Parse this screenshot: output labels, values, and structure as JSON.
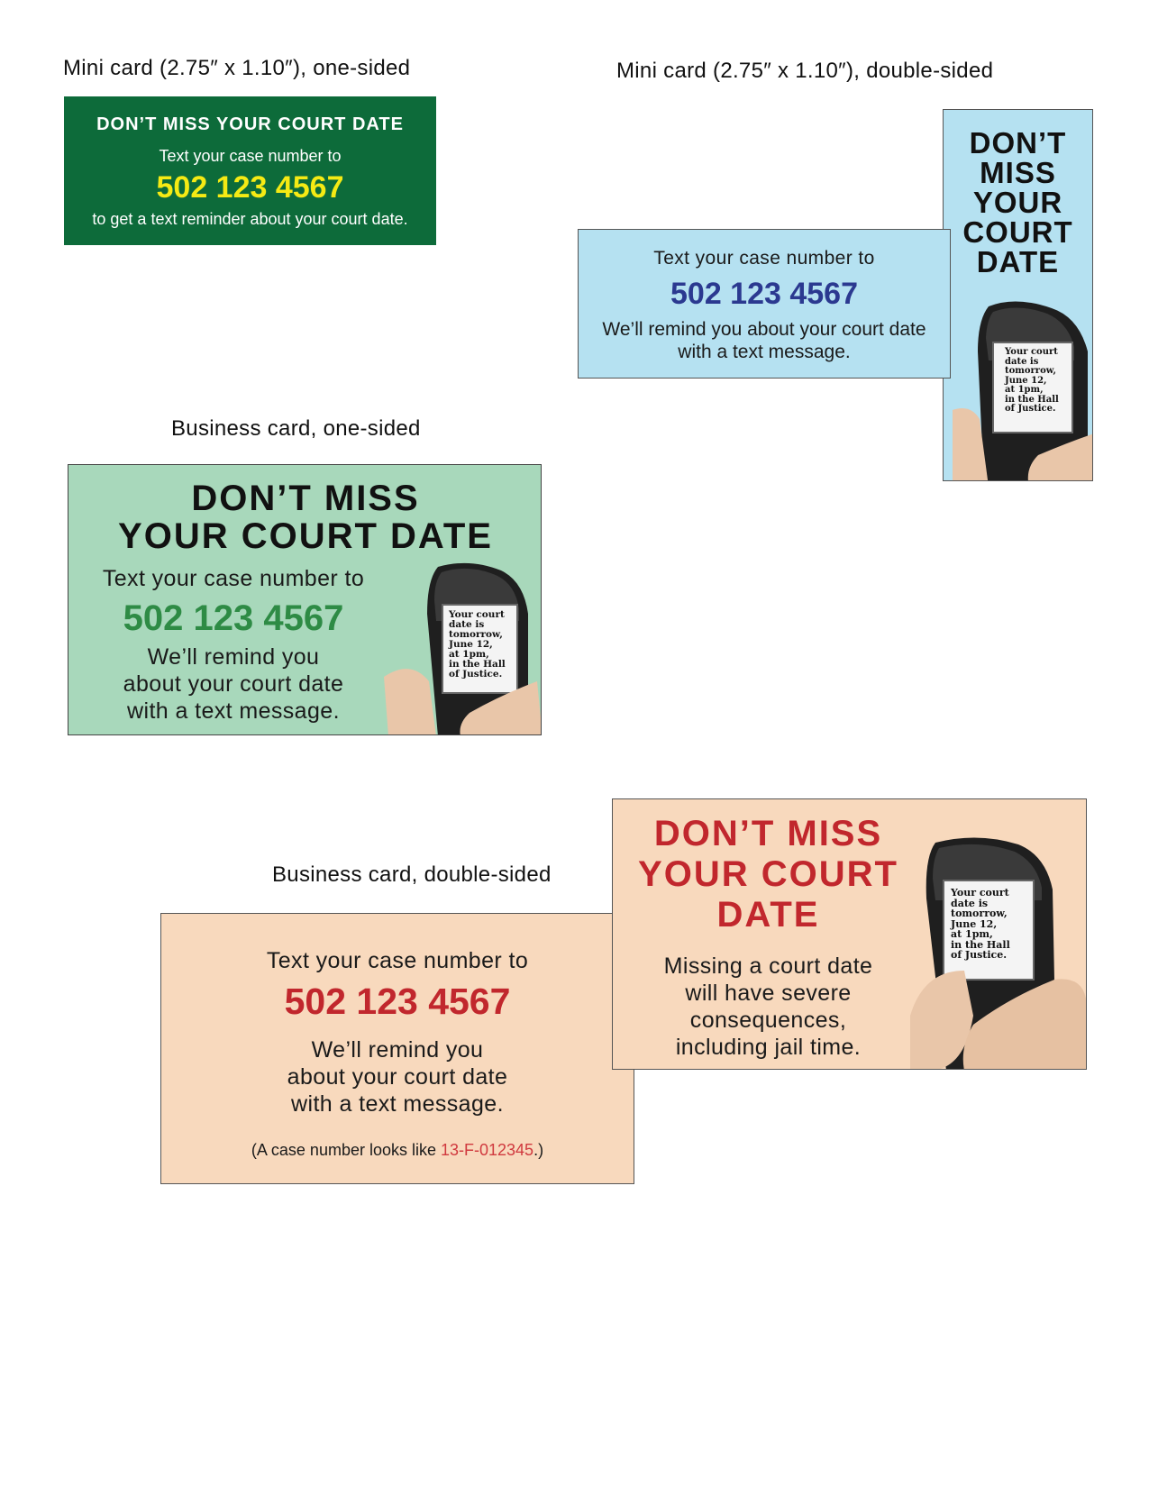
{
  "captions": {
    "mini_one": "Mini card (2.75″ x 1.10″), one-sided",
    "mini_double": "Mini card (2.75″ x 1.10″), double-sided",
    "business_one": "Business card, one-sided",
    "business_double": "Business card, double-sided"
  },
  "mini_one": {
    "headline": "DON’T MISS YOUR COURT DATE",
    "line1": "Text your case number to",
    "phone": "502 123 4567",
    "line2": "to get a text reminder about your court date."
  },
  "mini_double": {
    "front_headline": [
      "DON’T",
      "MISS",
      "YOUR",
      "COURT",
      "DATE"
    ],
    "back_line1": "Text your case number to",
    "back_phone": "502 123 4567",
    "back_line2a": "We’ll remind you about your court date",
    "back_line2b": "with a text message."
  },
  "business_one": {
    "headline_a": "DON’T MISS",
    "headline_b": "YOUR COURT DATE",
    "line1": "Text your case number to",
    "phone": "502 123 4567",
    "line2": [
      "We’ll remind you",
      "about your court date",
      "with a text message."
    ]
  },
  "business_double": {
    "front_headline": [
      "DON’T MISS",
      "YOUR COURT",
      "DATE"
    ],
    "front_text": [
      "Missing a court date",
      "will have severe",
      "consequences,",
      "including jail time."
    ],
    "back_line1": "Text your case number to",
    "back_phone": "502 123 4567",
    "back_line2": [
      "We’ll remind you",
      "about your court date",
      "with a text message."
    ],
    "example_prefix": "(A case number looks like ",
    "example_number": "13-F-012345",
    "example_suffix": ".)"
  },
  "phone_screen": [
    "Your court",
    "date is",
    "tomorrow,",
    "June 12,",
    "at 1pm,",
    "in the Hall",
    "of Justice."
  ],
  "colors": {
    "mini_green": "#0d6b3a",
    "mini_yellow": "#f5ea14",
    "light_blue": "#b5e1f1",
    "navy": "#2b3990",
    "mint": "#a8d8bb",
    "green_number": "#2e8b45",
    "peach": "#f8d9bd",
    "red": "#c1272d"
  }
}
